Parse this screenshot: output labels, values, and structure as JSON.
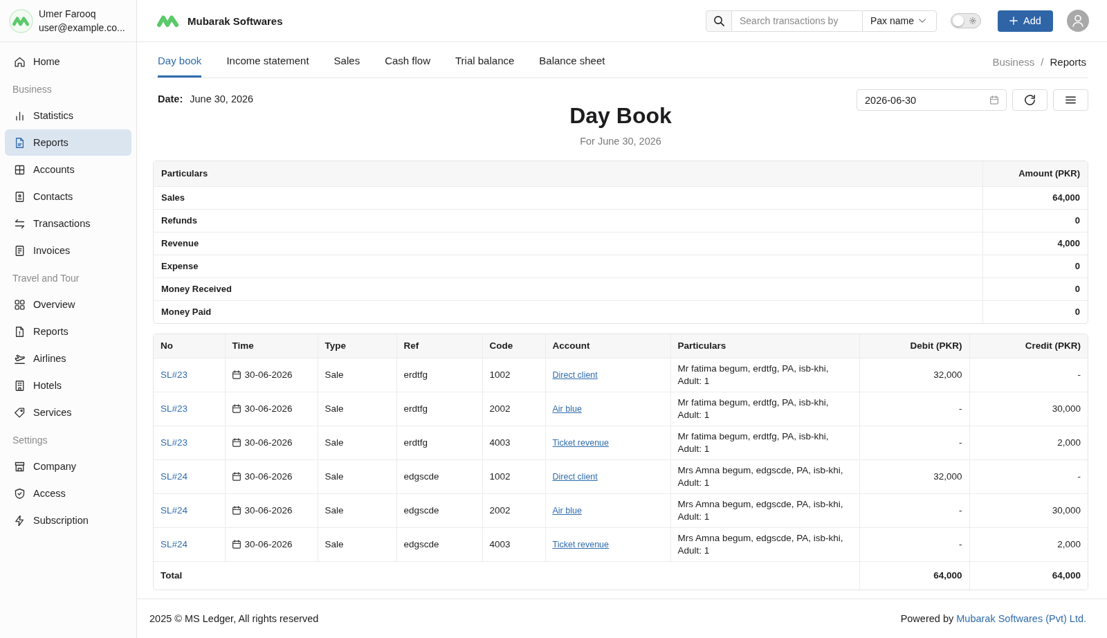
{
  "sidebar": {
    "user": {
      "name": "Umer Farooq",
      "email": "user@example.co..."
    },
    "sections": [
      {
        "items": [
          {
            "label": "Home",
            "selected": false
          }
        ]
      },
      {
        "title": "Business",
        "items": [
          {
            "label": "Statistics",
            "selected": false
          },
          {
            "label": "Reports",
            "selected": true
          },
          {
            "label": "Accounts",
            "selected": false
          },
          {
            "label": "Contacts",
            "selected": false
          },
          {
            "label": "Transactions",
            "selected": false
          },
          {
            "label": "Invoices",
            "selected": false
          }
        ]
      },
      {
        "title": "Travel and Tour",
        "items": [
          {
            "label": "Overview",
            "selected": false
          },
          {
            "label": "Reports",
            "selected": false
          },
          {
            "label": "Airlines",
            "selected": false
          },
          {
            "label": "Hotels",
            "selected": false
          },
          {
            "label": "Services",
            "selected": false
          }
        ]
      },
      {
        "title": "Settings",
        "items": [
          {
            "label": "Company",
            "selected": false
          },
          {
            "label": "Access",
            "selected": false
          },
          {
            "label": "Subscription",
            "selected": false
          }
        ]
      }
    ]
  },
  "topbar": {
    "brand": "Mubarak Softwares",
    "search": {
      "placeholder": "Search transactions by",
      "filter": "Pax name"
    },
    "theme_toggle": {
      "on": false
    },
    "add_button": "Add"
  },
  "tabs": [
    {
      "label": "Day book",
      "selected": true
    },
    {
      "label": "Income statement",
      "selected": false
    },
    {
      "label": "Sales",
      "selected": false
    },
    {
      "label": "Cash flow",
      "selected": false
    },
    {
      "label": "Trial balance",
      "selected": false
    },
    {
      "label": "Balance sheet",
      "selected": false
    }
  ],
  "breadcrumb": {
    "parent": "Business",
    "separator": "/",
    "current": "Reports"
  },
  "report": {
    "date_label": "Date:",
    "date": "June 30, 2026",
    "title": "Day Book",
    "subtitle": "For June 30, 2026",
    "date_field": {
      "value": "2026-06-30"
    }
  },
  "summary_table": {
    "columns": [
      "Particulars",
      "Amount (PKR)"
    ],
    "rows": [
      {
        "label": "Sales",
        "amount": "64,000"
      },
      {
        "label": "Refunds",
        "amount": "0"
      },
      {
        "label": "Revenue",
        "amount": "4,000"
      },
      {
        "label": "Expense",
        "amount": "0"
      },
      {
        "label": "Money Received",
        "amount": "0"
      },
      {
        "label": "Money Paid",
        "amount": "0"
      }
    ]
  },
  "transactions_table": {
    "columns": [
      "No",
      "Time",
      "Type",
      "Ref",
      "Code",
      "Account",
      "Particulars",
      "Debit (PKR)",
      "Credit (PKR)"
    ],
    "rows": [
      {
        "no": "SL#23",
        "time": "30-06-2026",
        "type": "Sale",
        "ref": "erdtfg",
        "code": "1002",
        "account": "Direct client",
        "particulars": "Mr fatima begum, erdtfg, PA, isb-khi, Adult: 1",
        "debit": "32,000",
        "credit": "-"
      },
      {
        "no": "SL#23",
        "time": "30-06-2026",
        "type": "Sale",
        "ref": "erdtfg",
        "code": "2002",
        "account": "Air blue",
        "particulars": "Mr fatima begum, erdtfg, PA, isb-khi, Adult: 1",
        "debit": "-",
        "credit": "30,000"
      },
      {
        "no": "SL#23",
        "time": "30-06-2026",
        "type": "Sale",
        "ref": "erdtfg",
        "code": "4003",
        "account": "Ticket revenue",
        "particulars": "Mr fatima begum, erdtfg, PA, isb-khi, Adult: 1",
        "debit": "-",
        "credit": "2,000"
      },
      {
        "no": "SL#24",
        "time": "30-06-2026",
        "type": "Sale",
        "ref": "edgscde",
        "code": "1002",
        "account": "Direct client",
        "particulars": "Mrs Amna begum, edgscde, PA, isb-khi, Adult: 1",
        "debit": "32,000",
        "credit": "-"
      },
      {
        "no": "SL#24",
        "time": "30-06-2026",
        "type": "Sale",
        "ref": "edgscde",
        "code": "2002",
        "account": "Air blue",
        "particulars": "Mrs Amna begum, edgscde, PA, isb-khi, Adult: 1",
        "debit": "-",
        "credit": "30,000"
      },
      {
        "no": "SL#24",
        "time": "30-06-2026",
        "type": "Sale",
        "ref": "edgscde",
        "code": "4003",
        "account": "Ticket revenue",
        "particulars": "Mrs Amna begum, edgscde, PA, isb-khi, Adult: 1",
        "debit": "-",
        "credit": "2,000"
      }
    ],
    "total": {
      "label": "Total",
      "debit": "64,000",
      "credit": "64,000"
    }
  },
  "footer": {
    "copyright": "2025 © MS Ledger, All rights reserved",
    "powered_by": "Powered by",
    "link": "Mubarak Softwares (Pvt) Ltd."
  }
}
